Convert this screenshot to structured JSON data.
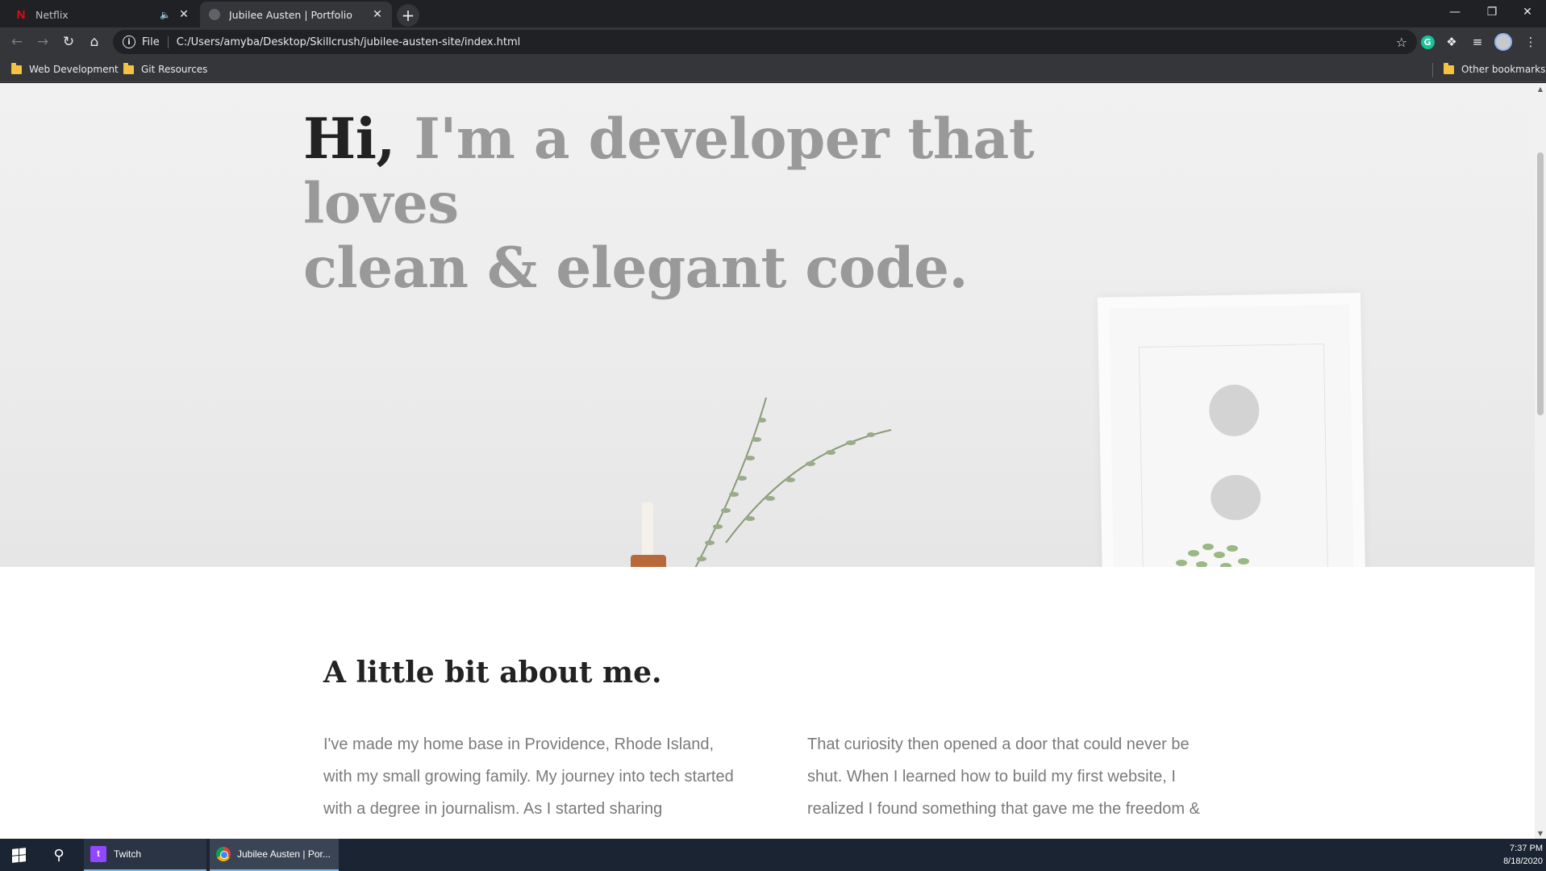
{
  "browser": {
    "tabs": [
      {
        "title": "Netflix",
        "active": false,
        "favicon": "netflix-icon"
      },
      {
        "title": "Jubilee Austen | Portfolio",
        "active": true,
        "favicon": "globe-icon"
      }
    ],
    "omnibox": {
      "scheme": "File",
      "url": "C:/Users/amyba/Desktop/Skillcrush/jubilee-austen-site/index.html"
    },
    "bookmarks": [
      {
        "label": "Web Development"
      },
      {
        "label": "Git Resources"
      }
    ],
    "other_bookmarks": "Other bookmarks",
    "accent": "#8ab4f8"
  },
  "page": {
    "hero": {
      "greeting": "Hi,",
      "tagline_line1": " I'm a developer that loves",
      "tagline_line2": "clean & elegant code."
    },
    "about": {
      "heading": "A little bit about me.",
      "left_paragraph": "I've made my home base in Providence, Rhode Island, with my small growing family. My journey into tech started with a degree in journalism. As I started sharing",
      "right_paragraph": "That curiosity then opened a door that could never be shut. When I learned how to build my first website, I realized I found something that gave me the freedom &"
    }
  },
  "taskbar": {
    "apps": [
      {
        "label": "Twitch",
        "icon": "twitch-icon"
      },
      {
        "label": "Jubilee Austen | Por...",
        "icon": "chrome-icon"
      }
    ],
    "time": "7:37 PM",
    "date": "8/18/2020"
  }
}
